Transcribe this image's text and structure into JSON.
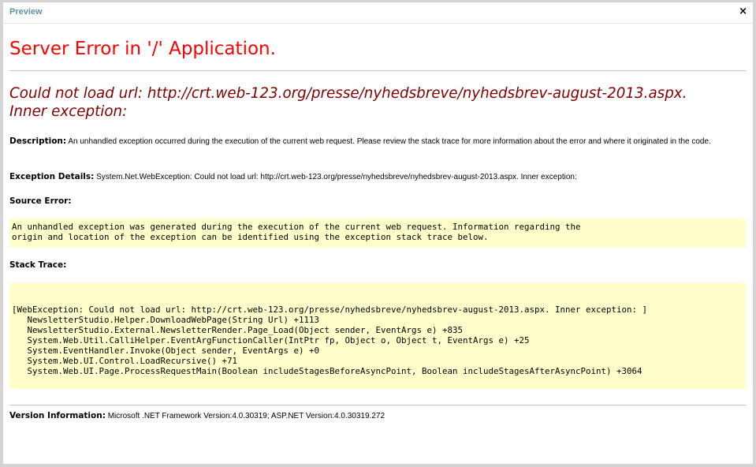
{
  "window": {
    "title": "Preview",
    "close_label": "×"
  },
  "error": {
    "heading": "Server Error in '/' Application.",
    "message_line1": "Could not load url: http://crt.web-123.org/presse/nyhedsbreve/nyhedsbrev-august-2013.aspx.",
    "message_line2": "Inner exception:",
    "description_label": "Description:",
    "description_text": "An unhandled exception occurred during the execution of the current web request. Please review the stack trace for more information about the error and where it originated in the code.",
    "exception_label": "Exception Details:",
    "exception_text": "System.Net.WebException: Could not load url: http://crt.web-123.org/presse/nyhedsbreve/nyhedsbrev-august-2013.aspx. Inner exception:",
    "source_error_label": "Source Error:",
    "source_error_lines": [
      "An unhandled exception was generated during the execution of the current web request. Information regarding the",
      "origin and location of the exception can be identified using the exception stack trace below."
    ],
    "stack_trace_label": "Stack Trace:",
    "stack_trace_lines": [
      "[WebException: Could not load url: http://crt.web-123.org/presse/nyhedsbreve/nyhedsbrev-august-2013.aspx. Inner exception: ]",
      "   NewsletterStudio.Helper.DownloadWebPage(String Url) +1113",
      "   NewsletterStudio.External.NewsletterRender.Page_Load(Object sender, EventArgs e) +835",
      "   System.Web.Util.CalliHelper.EventArgFunctionCaller(IntPtr fp, Object o, Object t, EventArgs e) +25",
      "   System.EventHandler.Invoke(Object sender, EventArgs e) +0",
      "   System.Web.UI.Control.LoadRecursive() +71",
      "   System.Web.UI.Page.ProcessRequestMain(Boolean includeStagesBeforeAsyncPoint, Boolean includeStagesAfterAsyncPoint) +3064"
    ],
    "version_label": "Version Information:",
    "version_text": "Microsoft .NET Framework Version:4.0.30319; ASP.NET Version:4.0.30319.272"
  }
}
